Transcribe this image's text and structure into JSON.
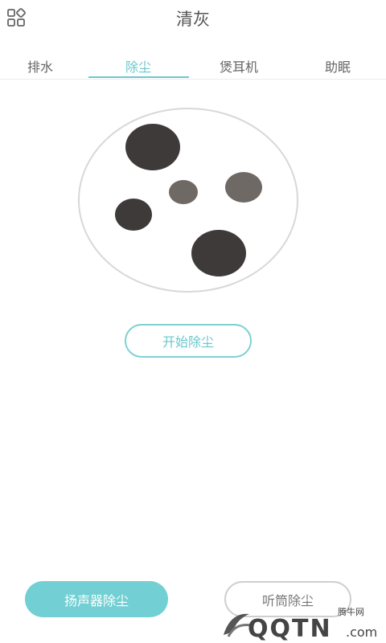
{
  "header": {
    "title": "清灰",
    "menu_icon": "grid-icon"
  },
  "tabs": [
    {
      "label": "排水",
      "active": false
    },
    {
      "label": "除尘",
      "active": true
    },
    {
      "label": "煲耳机",
      "active": false
    },
    {
      "label": "助眠",
      "active": false
    }
  ],
  "main": {
    "start_button": "开始除尘"
  },
  "bottom": {
    "speaker_button": "扬声器除尘",
    "earpiece_button": "听筒除尘"
  },
  "watermark": {
    "small": "腾牛网",
    "brand": "QQTN",
    "suffix": ".com"
  },
  "colors": {
    "accent": "#6ac8cc",
    "dust_dark": "#3f3a3a",
    "dust_light": "#6f6966",
    "circle_border": "#d8d8d8"
  }
}
